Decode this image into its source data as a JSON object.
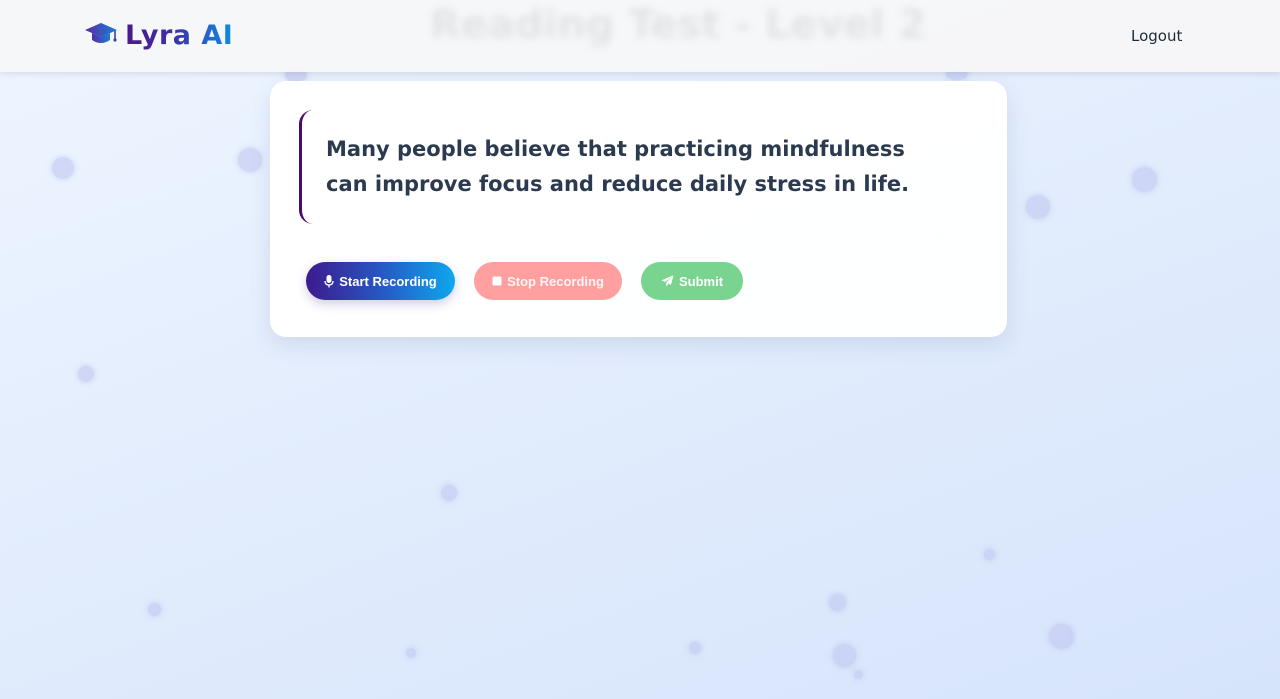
{
  "header": {
    "brand": "Lyra AI",
    "ghost_title": "Reading Test - Level 2",
    "logout_label": "Logout"
  },
  "passage": {
    "text": "Many people believe that practicing mindfulness can improve focus and reduce daily stress in life."
  },
  "actions": {
    "start_label": "Start Recording",
    "stop_label": "Stop Recording",
    "submit_label": "Submit"
  },
  "icons": {
    "brand": "graduation-cap-icon",
    "start": "microphone-icon",
    "stop": "stop-square-icon",
    "submit": "paper-plane-icon"
  },
  "colors": {
    "brand_start": "#4a1a8a",
    "brand_end": "#0d8ee0",
    "quote_border": "#4b0a70",
    "stop_button": "#ff9f9f",
    "submit_button": "#78d48e"
  }
}
